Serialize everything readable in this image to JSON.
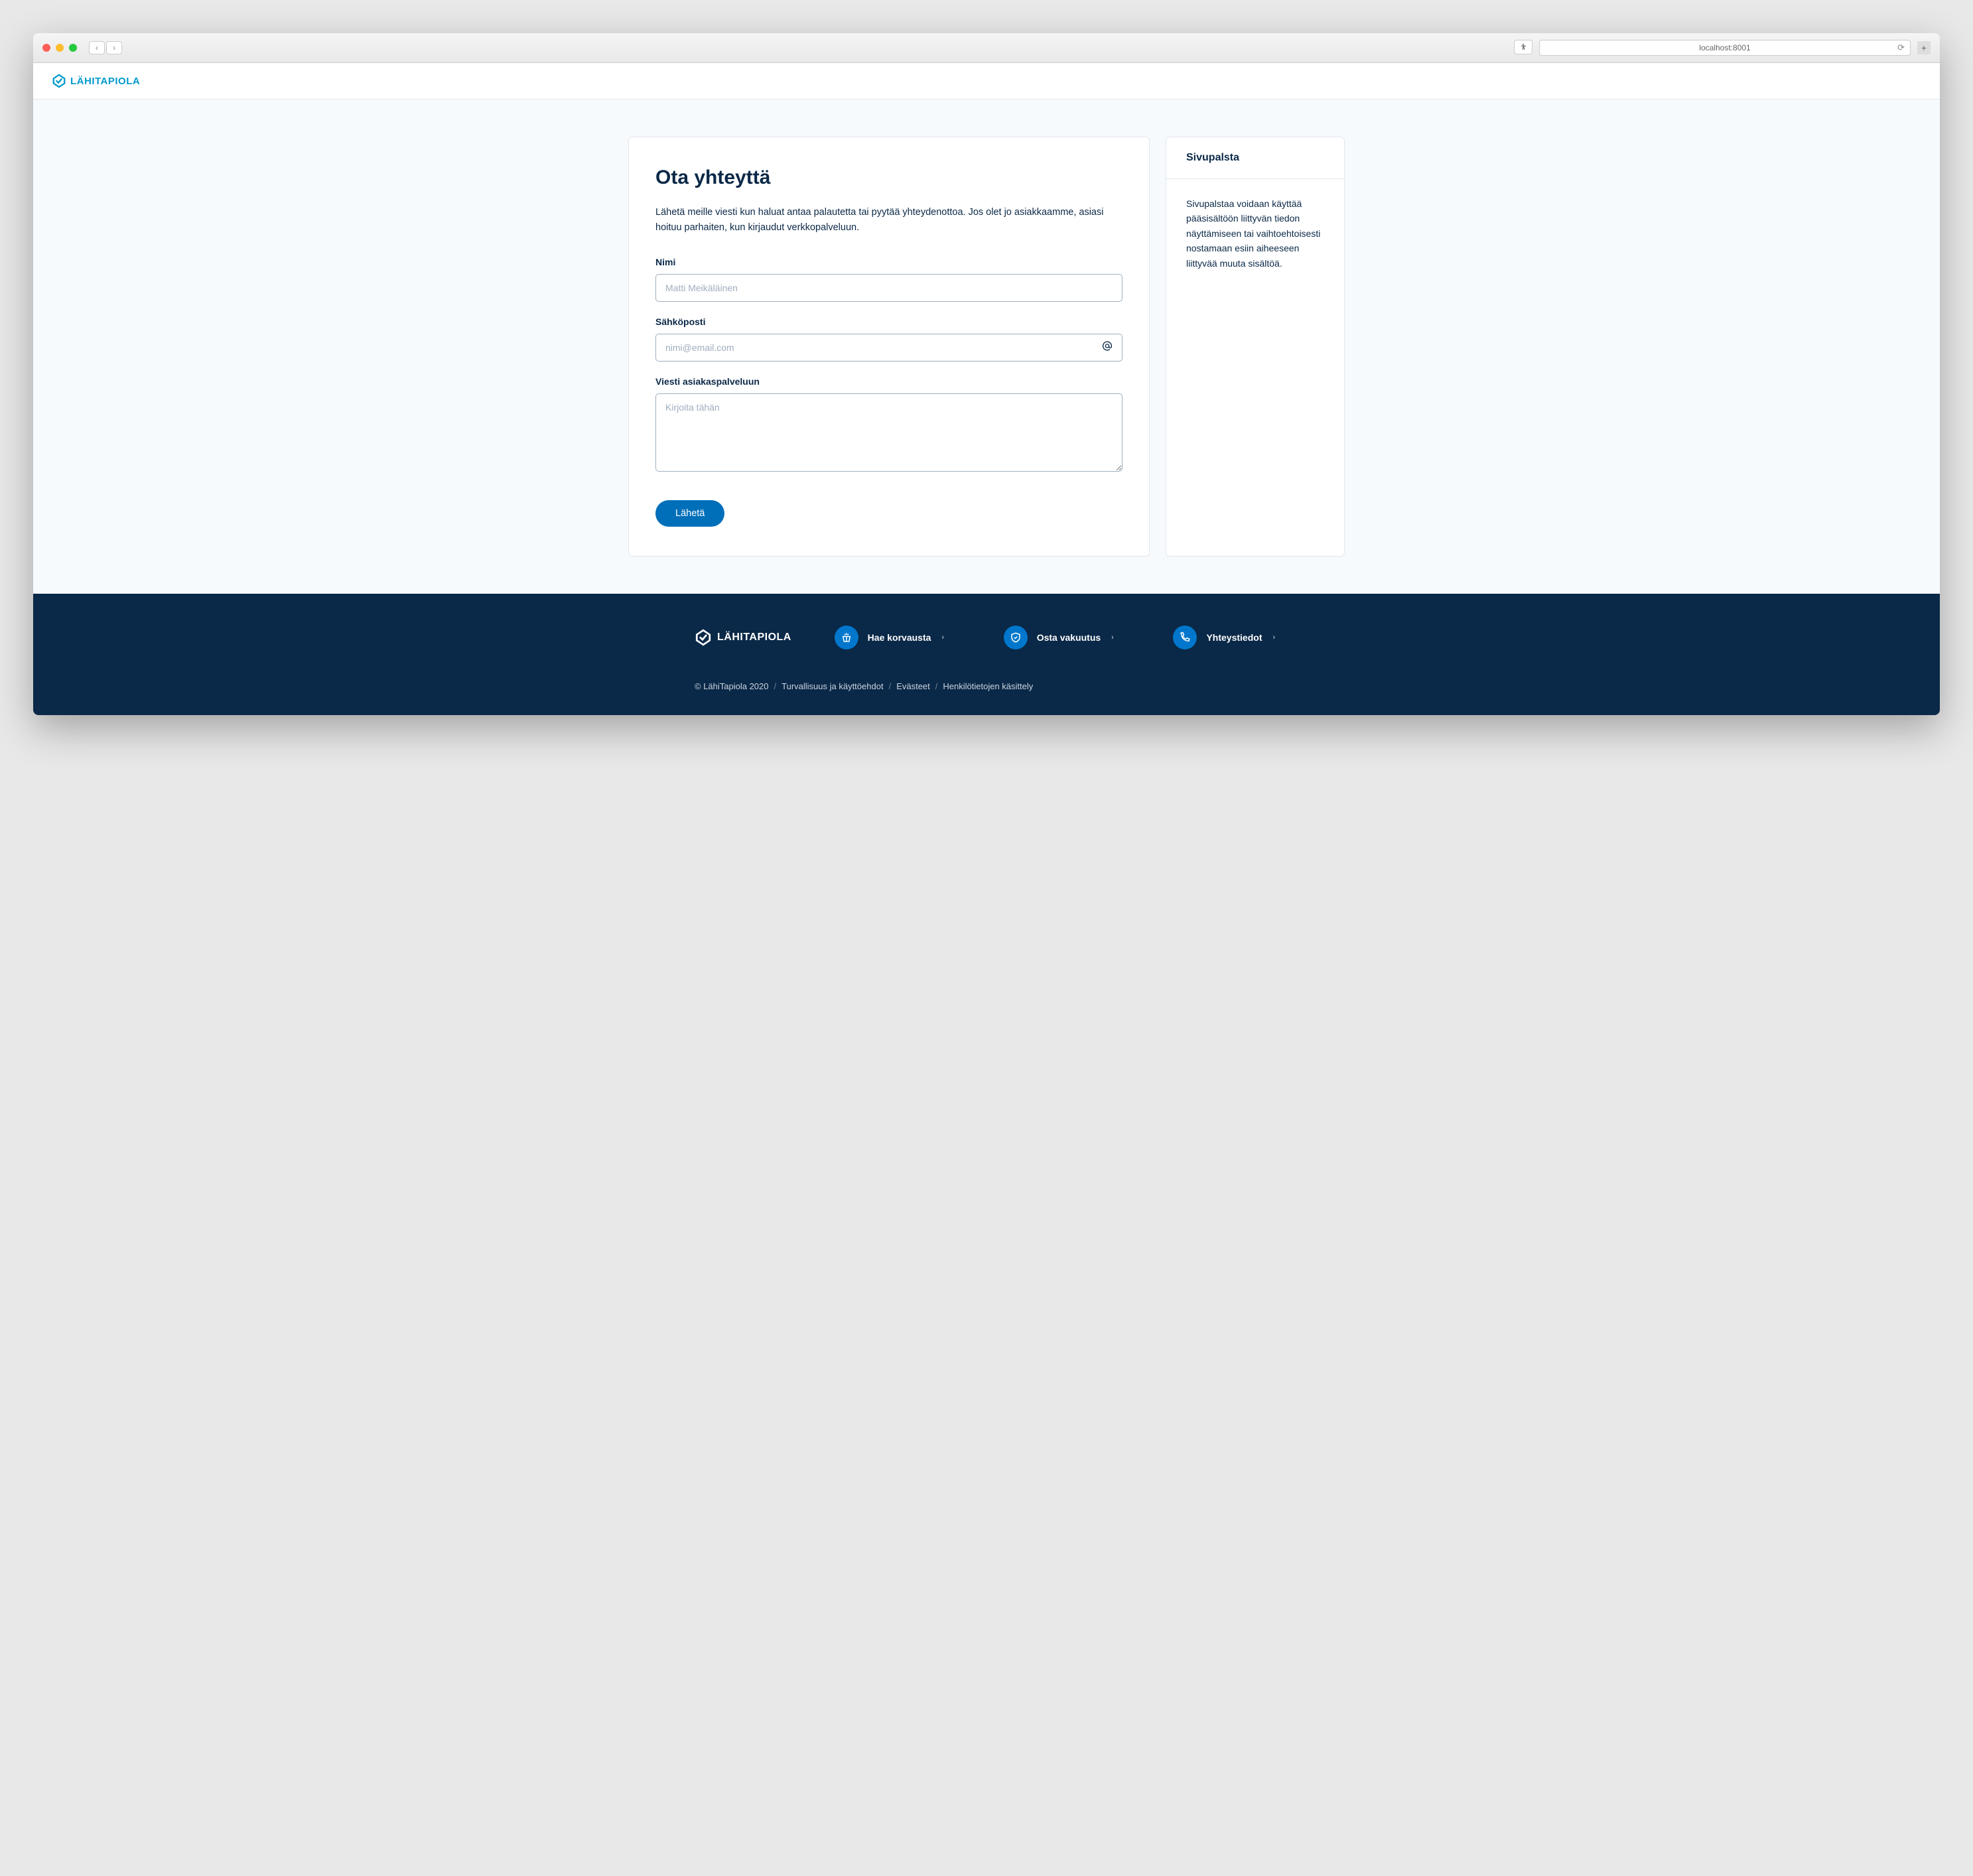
{
  "browser": {
    "url": "localhost:8001"
  },
  "header": {
    "brand": "LÄHITAPIOLA"
  },
  "main": {
    "title": "Ota yhteyttä",
    "intro": "Lähetä meille viesti kun haluat antaa palautetta tai pyytää yhteydenottoa. Jos olet jo asiakkaamme, asiasi hoituu parhaiten, kun kirjaudut verkkopalveluun.",
    "fields": {
      "name": {
        "label": "Nimi",
        "placeholder": "Matti Meikäläinen"
      },
      "email": {
        "label": "Sähköposti",
        "placeholder": "nimi@email.com"
      },
      "message": {
        "label": "Viesti asiakaspalveluun",
        "placeholder": "Kirjoita tähän"
      }
    },
    "submit": "Lähetä"
  },
  "sidebar": {
    "title": "Sivupalsta",
    "body": "Sivupalstaa voidaan käyttää pääsisältöön liittyvän tiedon näyttämiseen tai vaihtoehtoisesti nostamaan esiin aiheeseen liittyvää muuta sisältöä."
  },
  "footer": {
    "brand": "LÄHITAPIOLA",
    "links": [
      {
        "label": "Hae korvausta"
      },
      {
        "label": "Osta vakuutus"
      },
      {
        "label": "Yhteystiedot"
      }
    ],
    "bottom": {
      "copyright": "© LähiTapiola 2020",
      "items": [
        "Turvallisuus ja käyttöehdot",
        "Evästeet",
        "Henkilötietojen käsittely"
      ]
    }
  }
}
